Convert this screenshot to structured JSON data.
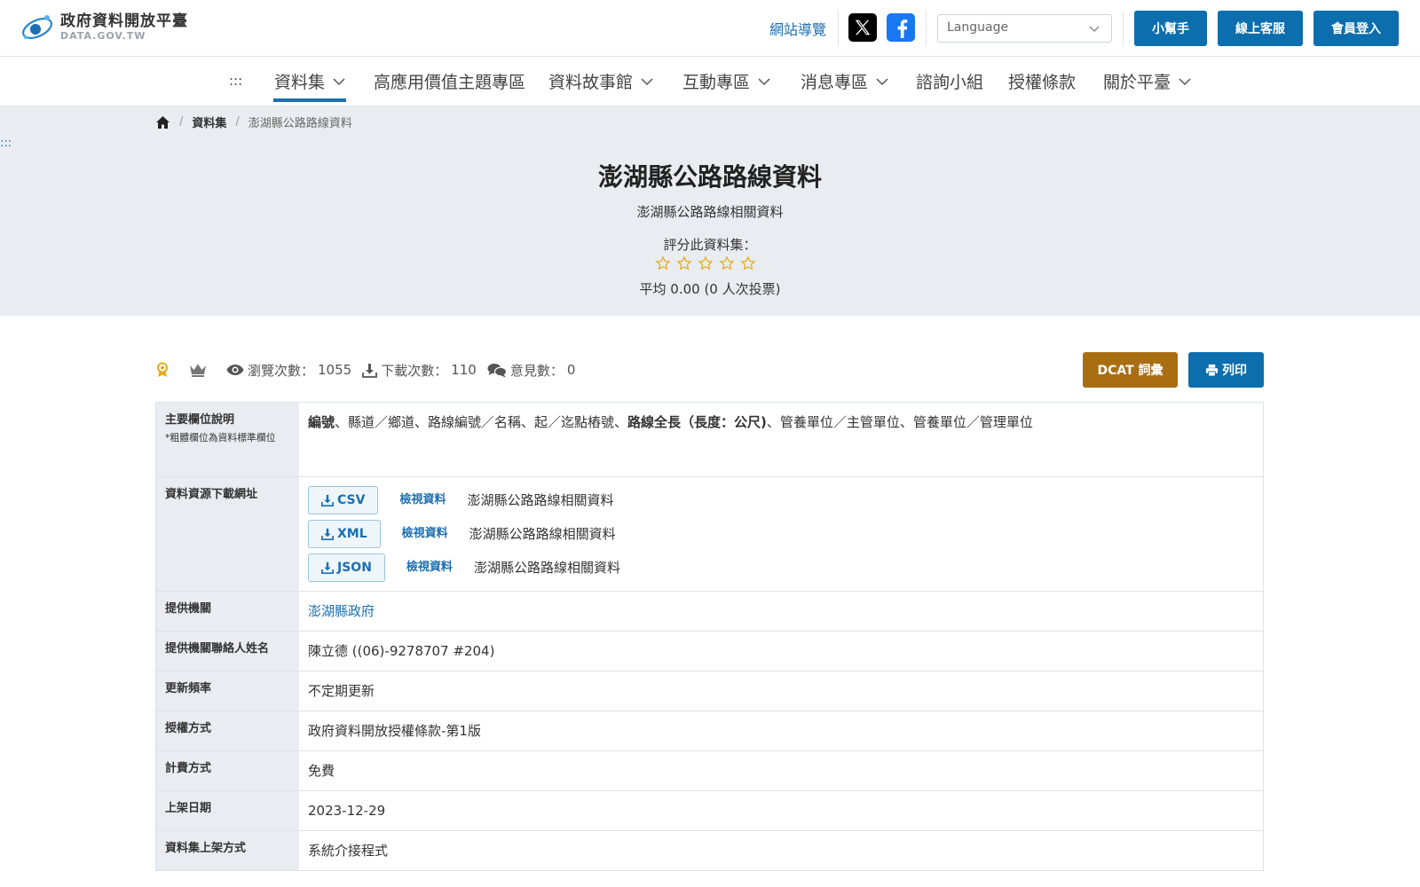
{
  "header": {
    "logo_title": "政府資料開放平臺",
    "logo_sub": "DATA.GOV.TW",
    "sitemap": "網站導覽",
    "language_placeholder": "Language",
    "buttons": [
      "小幫手",
      "線上客服",
      "會員登入"
    ]
  },
  "nav": {
    "accesskey": ":::",
    "items": [
      {
        "label": "資料集",
        "has_menu": true,
        "active": true
      },
      {
        "label": "高應用價值主題專區",
        "has_menu": false
      },
      {
        "label": "資料故事館",
        "has_menu": true
      },
      {
        "label": "互動專區",
        "has_menu": true
      },
      {
        "label": "消息專區",
        "has_menu": true
      },
      {
        "label": "諮詢小組",
        "has_menu": false
      },
      {
        "label": "授權條款",
        "has_menu": false
      },
      {
        "label": "關於平臺",
        "has_menu": true
      }
    ]
  },
  "breadcrumb": {
    "home_icon": "home-icon",
    "items": [
      "資料集",
      "澎湖縣公路路線資料"
    ]
  },
  "hero": {
    "accesskey": ":::",
    "title": "澎湖縣公路路線資料",
    "description": "澎湖縣公路路線相關資料",
    "rate_label": "評分此資料集：",
    "stars_filled": 0,
    "stars_total": 5,
    "average": "平均 0.00 (0 人次投票)"
  },
  "stats": {
    "views_label": "瀏覽次數：",
    "views": "1055",
    "downloads_label": "下載次數：",
    "downloads": "110",
    "comments_label": "意見數：",
    "comments": "0"
  },
  "actions": {
    "dcat": "DCAT 詞彙",
    "print": "列印"
  },
  "table": {
    "main_fields_header": "主要欄位說明",
    "main_fields_note": "*粗體欄位為資料標準欄位",
    "main_fields": [
      {
        "text": "編號",
        "bold": true
      },
      {
        "text": "、縣道／鄉道、路線編號／名稱、起／迄點樁號、",
        "bold": false
      },
      {
        "text": "路線全長（長度：公尺)",
        "bold": true
      },
      {
        "text": "、管養單位／主管單位、管養單位／管理單位",
        "bold": false
      }
    ],
    "resources_header": "資料資源下載網址",
    "resources": [
      {
        "format": "CSV",
        "view": "檢視資料",
        "desc": "澎湖縣公路路線相關資料"
      },
      {
        "format": "XML",
        "view": "檢視資料",
        "desc": "澎湖縣公路路線相關資料"
      },
      {
        "format": "JSON",
        "view": "檢視資料",
        "desc": "澎湖縣公路路線相關資料"
      }
    ],
    "rows": [
      {
        "label": "提供機關",
        "value": "澎湖縣政府",
        "link": true
      },
      {
        "label": "提供機關聯絡人姓名",
        "value": "陳立德 ((06)-9278707 #204)"
      },
      {
        "label": "更新頻率",
        "value": "不定期更新"
      },
      {
        "label": "授權方式",
        "value": "政府資料開放授權條款-第1版"
      },
      {
        "label": "計費方式",
        "value": "免費"
      },
      {
        "label": "上架日期",
        "value": "2023-12-29"
      },
      {
        "label": "資料集上架方式",
        "value": "系統介接程式"
      }
    ]
  },
  "colors": {
    "primary": "#0d6eae",
    "link": "#1c6fb0",
    "dcat": "#a96d12",
    "hero_bg": "#e9edf1",
    "star": "#e6a817"
  }
}
